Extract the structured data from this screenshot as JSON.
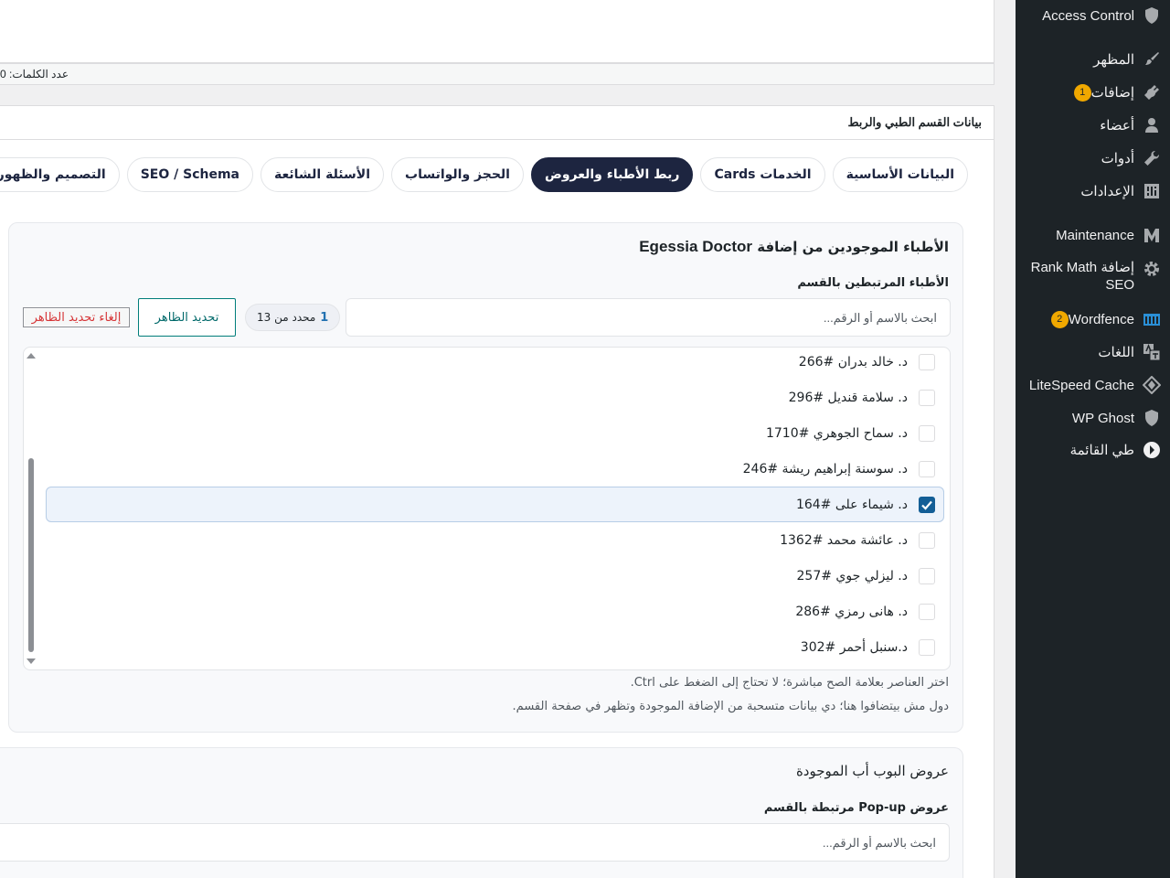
{
  "wordcount": {
    "label": "عدد الكلمات: 0"
  },
  "metabox": {
    "title": "بيانات القسم الطبي والربط"
  },
  "tabs": [
    {
      "label": "البيانات الأساسية"
    },
    {
      "label": "الخدمات Cards"
    },
    {
      "label": "ربط الأطباء والعروض"
    },
    {
      "label": "الحجز والواتساب"
    },
    {
      "label": "الأسئلة الشائعة"
    },
    {
      "label": "SEO / Schema"
    },
    {
      "label": "التصميم والظهور"
    }
  ],
  "doctors_panel": {
    "title_prefix": "الأطباء الموجودين من إضافة",
    "title_plugin": "Egessia Doctor",
    "subtitle": "الأطباء المرتبطين بالقسم",
    "search_placeholder": "ابحث بالاسم أو الرقم...",
    "selected_count": "1",
    "selected_suffix": "محدد من 13",
    "select_visible_label": "تحديد الظاهر",
    "deselect_visible_label": "إلغاء تحديد الظاهر",
    "doctors": [
      {
        "name": "د. خالد بدران #266",
        "checked": false
      },
      {
        "name": "د. سلامة قنديل #296",
        "checked": false
      },
      {
        "name": "د. سماح الجوهري #1710",
        "checked": false
      },
      {
        "name": "د. سوسنة إبراهيم ريشة #246",
        "checked": false
      },
      {
        "name": "د. شيماء على #164",
        "checked": true
      },
      {
        "name": "د. عائشة محمد #1362",
        "checked": false
      },
      {
        "name": "د. ليزلي جوي #257",
        "checked": false
      },
      {
        "name": "د. هانى رمزي #286",
        "checked": false
      },
      {
        "name": "د.سنبل أحمر #302",
        "checked": false
      }
    ],
    "hint_1": "اختر العناصر بعلامة الصح مباشرة؛ لا تحتاج إلى الضغط على Ctrl.",
    "hint_2": "دول مش بيتضافوا هنا؛ دي بيانات متسحبة من الإضافة الموجودة وتظهر في صفحة القسم."
  },
  "popups_panel": {
    "title": "عروض البوب أب الموجودة",
    "subtitle": "عروض Pop-up مرتبطة بالقسم",
    "search_placeholder": "ابحث بالاسم أو الرقم..."
  },
  "sidebar": {
    "items": [
      {
        "label": "Access Control",
        "icon": "shield-icon"
      },
      {
        "label": "المظهر",
        "icon": "paintbrush-icon"
      },
      {
        "label": "إضافات",
        "icon": "plugin-icon",
        "badge": "1"
      },
      {
        "label": "أعضاء",
        "icon": "user-icon"
      },
      {
        "label": "أدوات",
        "icon": "wrench-icon"
      },
      {
        "label": "الإعدادات",
        "icon": "settings-icon"
      },
      {
        "label": "Maintenance",
        "icon": "maintenance-icon"
      },
      {
        "label": "Rank Math إضافة",
        "label2": "SEO",
        "icon": "gear-icon"
      },
      {
        "label": "Wordfence",
        "icon": "wordfence-icon",
        "badge": "2"
      },
      {
        "label": "اللغات",
        "icon": "translate-icon"
      },
      {
        "label": "LiteSpeed Cache",
        "icon": "litespeed-icon"
      },
      {
        "label": "WP Ghost",
        "icon": "ghost-shield-icon"
      },
      {
        "label": "طي القائمة",
        "icon": "collapse-icon"
      }
    ]
  },
  "colors": {
    "accent_navy": "#1d2540",
    "sidebar_bg": "#1d2327",
    "badge": "#f0a800",
    "link_blue": "#2271b1"
  }
}
